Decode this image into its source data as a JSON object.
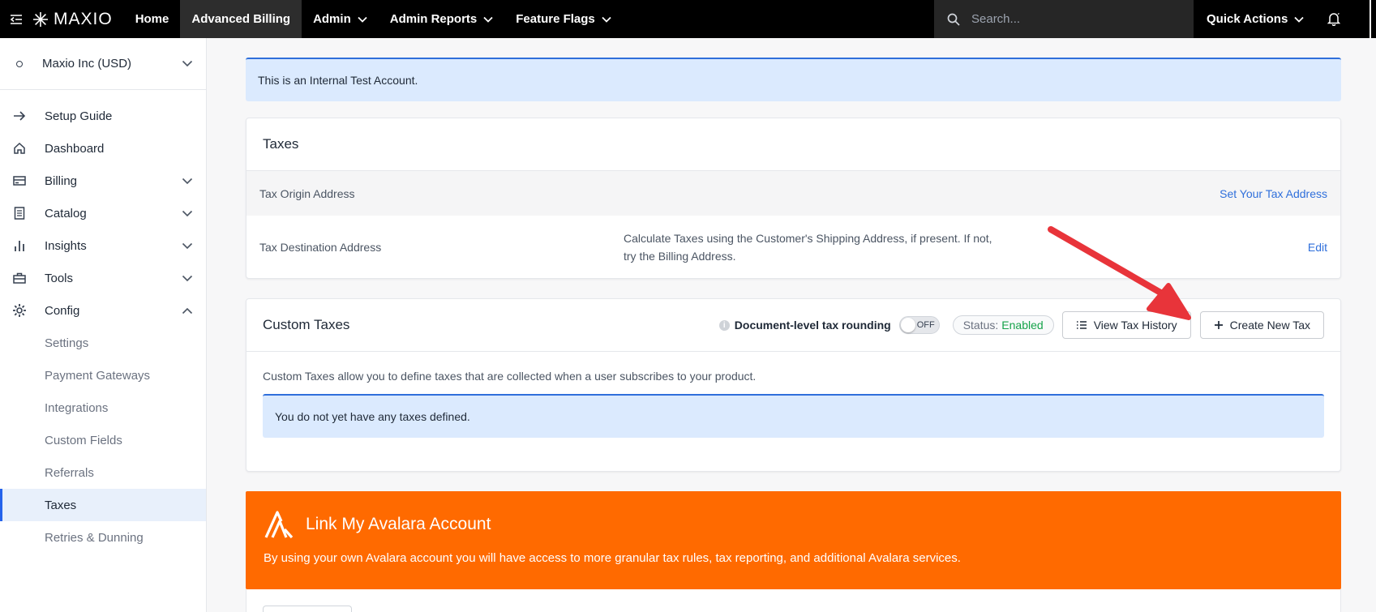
{
  "topnav": {
    "brand": "MAXIO",
    "items": [
      {
        "label": "Home",
        "dropdown": false,
        "active": false
      },
      {
        "label": "Advanced Billing",
        "dropdown": false,
        "active": true
      },
      {
        "label": "Admin",
        "dropdown": true,
        "active": false
      },
      {
        "label": "Admin Reports",
        "dropdown": true,
        "active": false
      },
      {
        "label": "Feature Flags",
        "dropdown": true,
        "active": false
      }
    ],
    "search_placeholder": "Search...",
    "quick_actions": "Quick Actions"
  },
  "sidebar": {
    "account": "Maxio Inc (USD)",
    "items": [
      {
        "label": "Setup Guide",
        "icon": "arrow-right-icon"
      },
      {
        "label": "Dashboard",
        "icon": "home-icon"
      },
      {
        "label": "Billing",
        "icon": "billing-icon",
        "chevron": "down"
      },
      {
        "label": "Catalog",
        "icon": "catalog-icon",
        "chevron": "down"
      },
      {
        "label": "Insights",
        "icon": "bar-chart-icon",
        "chevron": "down"
      },
      {
        "label": "Tools",
        "icon": "briefcase-icon",
        "chevron": "down"
      },
      {
        "label": "Config",
        "icon": "gear-icon",
        "chevron": "up"
      }
    ],
    "config_sub": [
      {
        "label": "Settings",
        "active": false
      },
      {
        "label": "Payment Gateways",
        "active": false
      },
      {
        "label": "Integrations",
        "active": false
      },
      {
        "label": "Custom Fields",
        "active": false
      },
      {
        "label": "Referrals",
        "active": false
      },
      {
        "label": "Taxes",
        "active": true
      },
      {
        "label": "Retries & Dunning",
        "active": false
      }
    ]
  },
  "banner": "This is an Internal Test Account.",
  "taxes": {
    "title": "Taxes",
    "origin_label": "Tax Origin Address",
    "origin_link": "Set Your Tax Address",
    "dest_label": "Tax Destination Address",
    "dest_text_1": "Calculate Taxes using the Customer's Shipping Address, if present. If not,",
    "dest_text_2": "try the Billing Address.",
    "dest_link": "Edit"
  },
  "custom_taxes": {
    "title": "Custom Taxes",
    "info": "i",
    "rounding_label": "Document-level tax rounding",
    "toggle_state": "OFF",
    "status_label": "Status:",
    "status_value": "Enabled",
    "history_button": "View Tax History",
    "create_button": "Create New Tax",
    "description": "Custom Taxes allow you to define taxes that are collected when a user subscribes to your product.",
    "empty_message": "You do not yet have any taxes defined."
  },
  "avalara": {
    "title": "Link My Avalara Account",
    "description": "By using your own Avalara account you will have access to more granular tax rules, tax reporting, and additional Avalara services."
  },
  "colors": {
    "accent": "#2f6fdb",
    "avalara": "#ff6a00",
    "annotation_arrow": "#e8343a",
    "enabled": "#16a34a"
  }
}
